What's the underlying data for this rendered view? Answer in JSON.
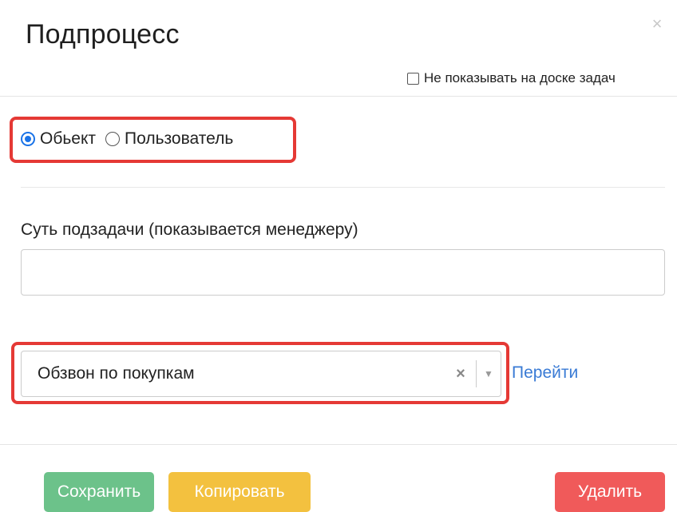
{
  "dialog": {
    "title": "Подпроцесс",
    "close_icon": "×",
    "hide_on_board_label": "Не показывать на доске задач",
    "hide_on_board_checked": false
  },
  "target_type": {
    "options": [
      "Обьект",
      "Пользователь"
    ],
    "selected": "Обьект"
  },
  "subtask": {
    "label": "Суть подзадачи (показывается менеджеру)",
    "value": ""
  },
  "process_select": {
    "value": "Обзвон по покупкам",
    "clear_icon": "×",
    "arrow_icon": "▼",
    "goto_label": "Перейти"
  },
  "footer": {
    "save_label": "Сохранить",
    "copy_label": "Копировать",
    "delete_label": "Удалить"
  },
  "colors": {
    "highlight": "#e53935",
    "save": "#6cc28a",
    "copy": "#f3c13f",
    "delete": "#f05a5a",
    "link": "#3a7bd5",
    "radio_selected": "#1a73e8"
  }
}
